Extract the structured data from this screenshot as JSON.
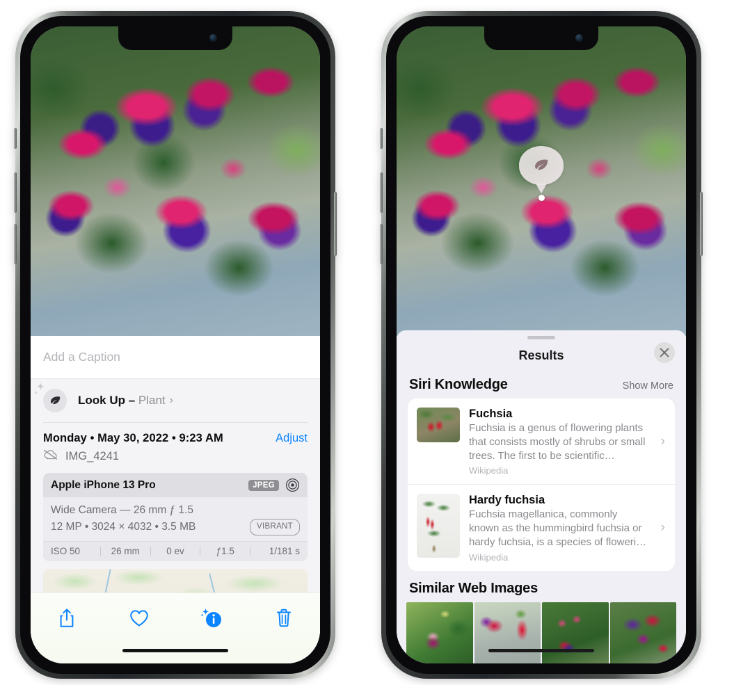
{
  "left_phone": {
    "photo": {
      "alt_name": "fuchsia-flowers-photo"
    },
    "caption_field": {
      "placeholder": "Add a Caption",
      "value": ""
    },
    "lookup_row": {
      "icon": "leaf-icon",
      "label": "Look Up",
      "dash": " – ",
      "subject": "Plant",
      "chevron": "›"
    },
    "metadata": {
      "date": "Monday • May 30, 2022 • 9:23 AM",
      "adjust_label": "Adjust",
      "cloud_icon": "icloud-slash-icon",
      "filename": "IMG_4241"
    },
    "camera_card": {
      "model": "Apple iPhone 13 Pro",
      "format_tag": "JPEG",
      "lens_icon": "lens-icon",
      "lens_line": "Wide Camera — 26 mm ƒ 1.5",
      "specs_line": "12 MP • 3024 × 4032 • 3.5 MB",
      "style_tag": "VIBRANT",
      "exif": [
        "ISO 50",
        "26 mm",
        "0 ev",
        "ƒ1.5",
        "1/181 s"
      ]
    },
    "map": {
      "name": "location-map",
      "pin_thumb": "photo-pin-thumbnail"
    },
    "toolbar": [
      {
        "name": "share-button",
        "icon": "share-icon"
      },
      {
        "name": "favorite-button",
        "icon": "heart-icon"
      },
      {
        "name": "info-button",
        "icon": "info-sparkle-icon"
      },
      {
        "name": "delete-button",
        "icon": "trash-icon"
      }
    ],
    "accent_color": "#0a84ff"
  },
  "right_phone": {
    "photo": {
      "alt_name": "fuchsia-flowers-photo"
    },
    "visual_lookup_badge": {
      "icon": "leaf-icon",
      "name": "visual-look-up-badge"
    },
    "sheet": {
      "grabber": "sheet-grabber",
      "title": "Results",
      "close_icon": "close-icon"
    },
    "siri_knowledge": {
      "heading": "Siri Knowledge",
      "show_more": "Show More",
      "items": [
        {
          "title": "Fuchsia",
          "description": "Fuchsia is a genus of flowering plants that consists mostly of shrubs or small trees. The first to be scientific…",
          "source": "Wikipedia",
          "chevron": "›"
        },
        {
          "title": "Hardy fuchsia",
          "description": "Fuchsia magellanica, commonly known as the hummingbird fuchsia or hardy fuchsia, is a species of floweri…",
          "source": "Wikipedia",
          "chevron": "›"
        }
      ]
    },
    "similar_web_images": {
      "heading": "Similar Web Images",
      "tiles": [
        "web-image-1",
        "web-image-2",
        "web-image-3",
        "web-image-4"
      ]
    }
  }
}
